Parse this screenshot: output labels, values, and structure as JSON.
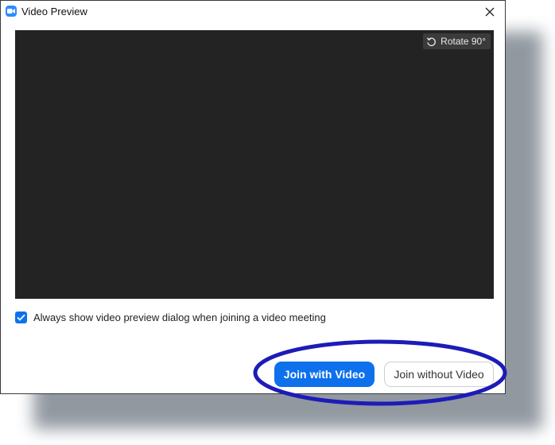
{
  "window": {
    "title": "Video Preview",
    "app_icon": "zoom-camera-icon",
    "close_icon": "close-icon"
  },
  "video": {
    "rotate_label": "Rotate 90°",
    "rotate_icon": "rotate-icon"
  },
  "preview_option": {
    "label": "Always show video preview dialog when joining a video meeting",
    "checked": true
  },
  "buttons": {
    "join_with_video": "Join with Video",
    "join_without_video": "Join without Video"
  },
  "colors": {
    "primary": "#0e71eb",
    "video_background": "#232323",
    "highlight": "#1c1cb8"
  }
}
